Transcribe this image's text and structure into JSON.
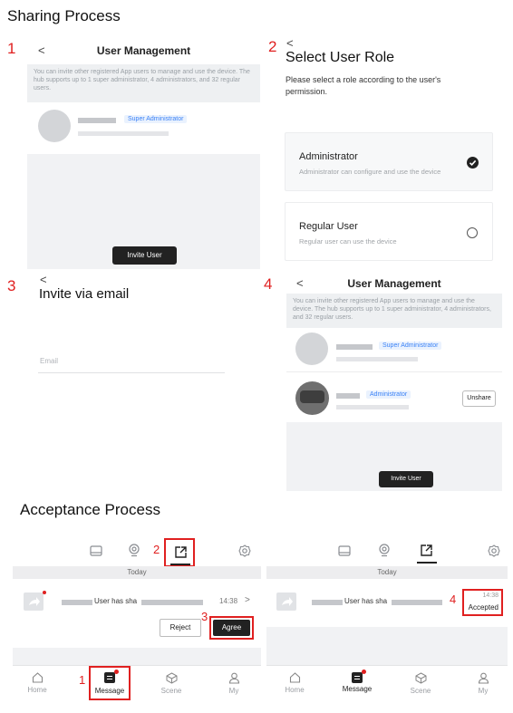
{
  "sharing": {
    "title": "Sharing Process",
    "step1": {
      "num": "1",
      "back": "<",
      "title": "User Management",
      "info": "You can invite other registered App users to manage and use the device. The hub supports up to 1 super administrator, 4 administrators, and 32 regular users.",
      "role_badge": "Super Administrator",
      "invite_button": "Invite User"
    },
    "step2": {
      "num": "2",
      "back": "<",
      "title": "Select User Role",
      "subtitle": "Please select a role according to the user's permission.",
      "roles": [
        {
          "title": "Administrator",
          "desc": "Administrator can configure and use the device",
          "selected": true,
          "icon": "check-filled-icon"
        },
        {
          "title": "Regular User",
          "desc": "Regular user can use the device",
          "selected": false,
          "icon": "radio-empty-icon"
        }
      ]
    },
    "step3": {
      "num": "3",
      "back": "<",
      "title": "Invite via email",
      "email_placeholder": "Email"
    },
    "step4": {
      "num": "4",
      "back": "<",
      "title": "User Management",
      "info": "You can invite other registered App users to manage and use the device. The hub supports up to 1 super administrator, 4 administrators, and 32 regular users.",
      "super_badge": "Super Administrator",
      "admin_badge": "Administrator",
      "unshare_button": "Unshare",
      "invite_button": "Invite User"
    }
  },
  "acceptance": {
    "title": "Acceptance Process",
    "left": {
      "tab_num": "2",
      "today": "Today",
      "message_text": "User has sha",
      "time": "14:38",
      "arrow": ">",
      "reject_button": "Reject",
      "agree_button": "Agree",
      "agree_num": "3",
      "nav_num": "1",
      "nav": [
        {
          "label": "Home",
          "icon": "home-icon"
        },
        {
          "label": "Message",
          "icon": "message-icon"
        },
        {
          "label": "Scene",
          "icon": "scene-icon"
        },
        {
          "label": "My",
          "icon": "user-icon"
        }
      ]
    },
    "right": {
      "today": "Today",
      "message_text": "User has sha",
      "status_num": "4",
      "time": "14:38",
      "status": "Accepted",
      "nav": [
        {
          "label": "Home",
          "icon": "home-icon"
        },
        {
          "label": "Message",
          "icon": "message-icon"
        },
        {
          "label": "Scene",
          "icon": "scene-icon"
        },
        {
          "label": "My",
          "icon": "user-icon"
        }
      ]
    }
  },
  "colors": {
    "annotation": "#e02020",
    "accent_blue": "#3b82f6",
    "dark_button": "#222222"
  }
}
